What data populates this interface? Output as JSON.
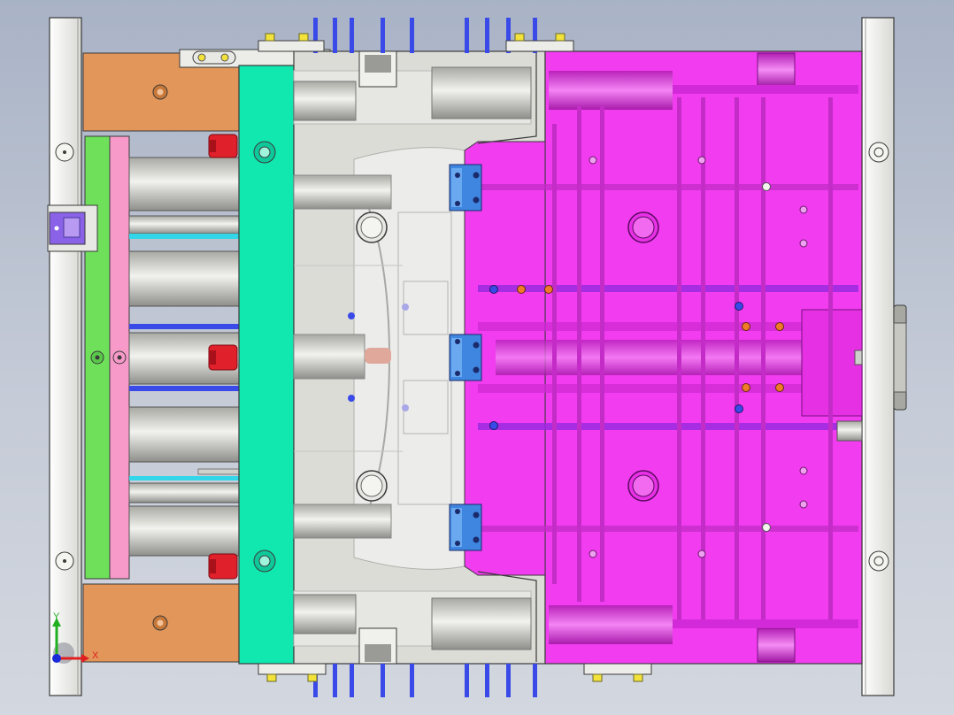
{
  "view": {
    "background_top": "#a9b3c6",
    "background_bottom": "#d3d7df"
  },
  "colors": {
    "clamp_plate": "#f3f3f0",
    "spacer_block": "#e2965a",
    "ejector_retainer": "#6fe05a",
    "ejector_plate": "#f79ac9",
    "support_plate": "#10e8b0",
    "core_plate": "#d9d9d4",
    "cavity_plate": "#f23cf0",
    "slide_block": "#3f86e0",
    "locating_block": "#8a62e8",
    "return_pin_head": "#e0202a",
    "cooling_line_blue": "#3a4ae8",
    "cooling_line_cyan": "#33d6e8",
    "plate_outline": "#3a3a3a",
    "pin_orange": "#f07a2a",
    "pin_yellow": "#f2e23a",
    "axis_x": "#e02020",
    "axis_y": "#20b020",
    "axis_z": "#1a2ad8"
  },
  "axis_triad": {
    "x_label": "X",
    "y_label": "Y"
  }
}
